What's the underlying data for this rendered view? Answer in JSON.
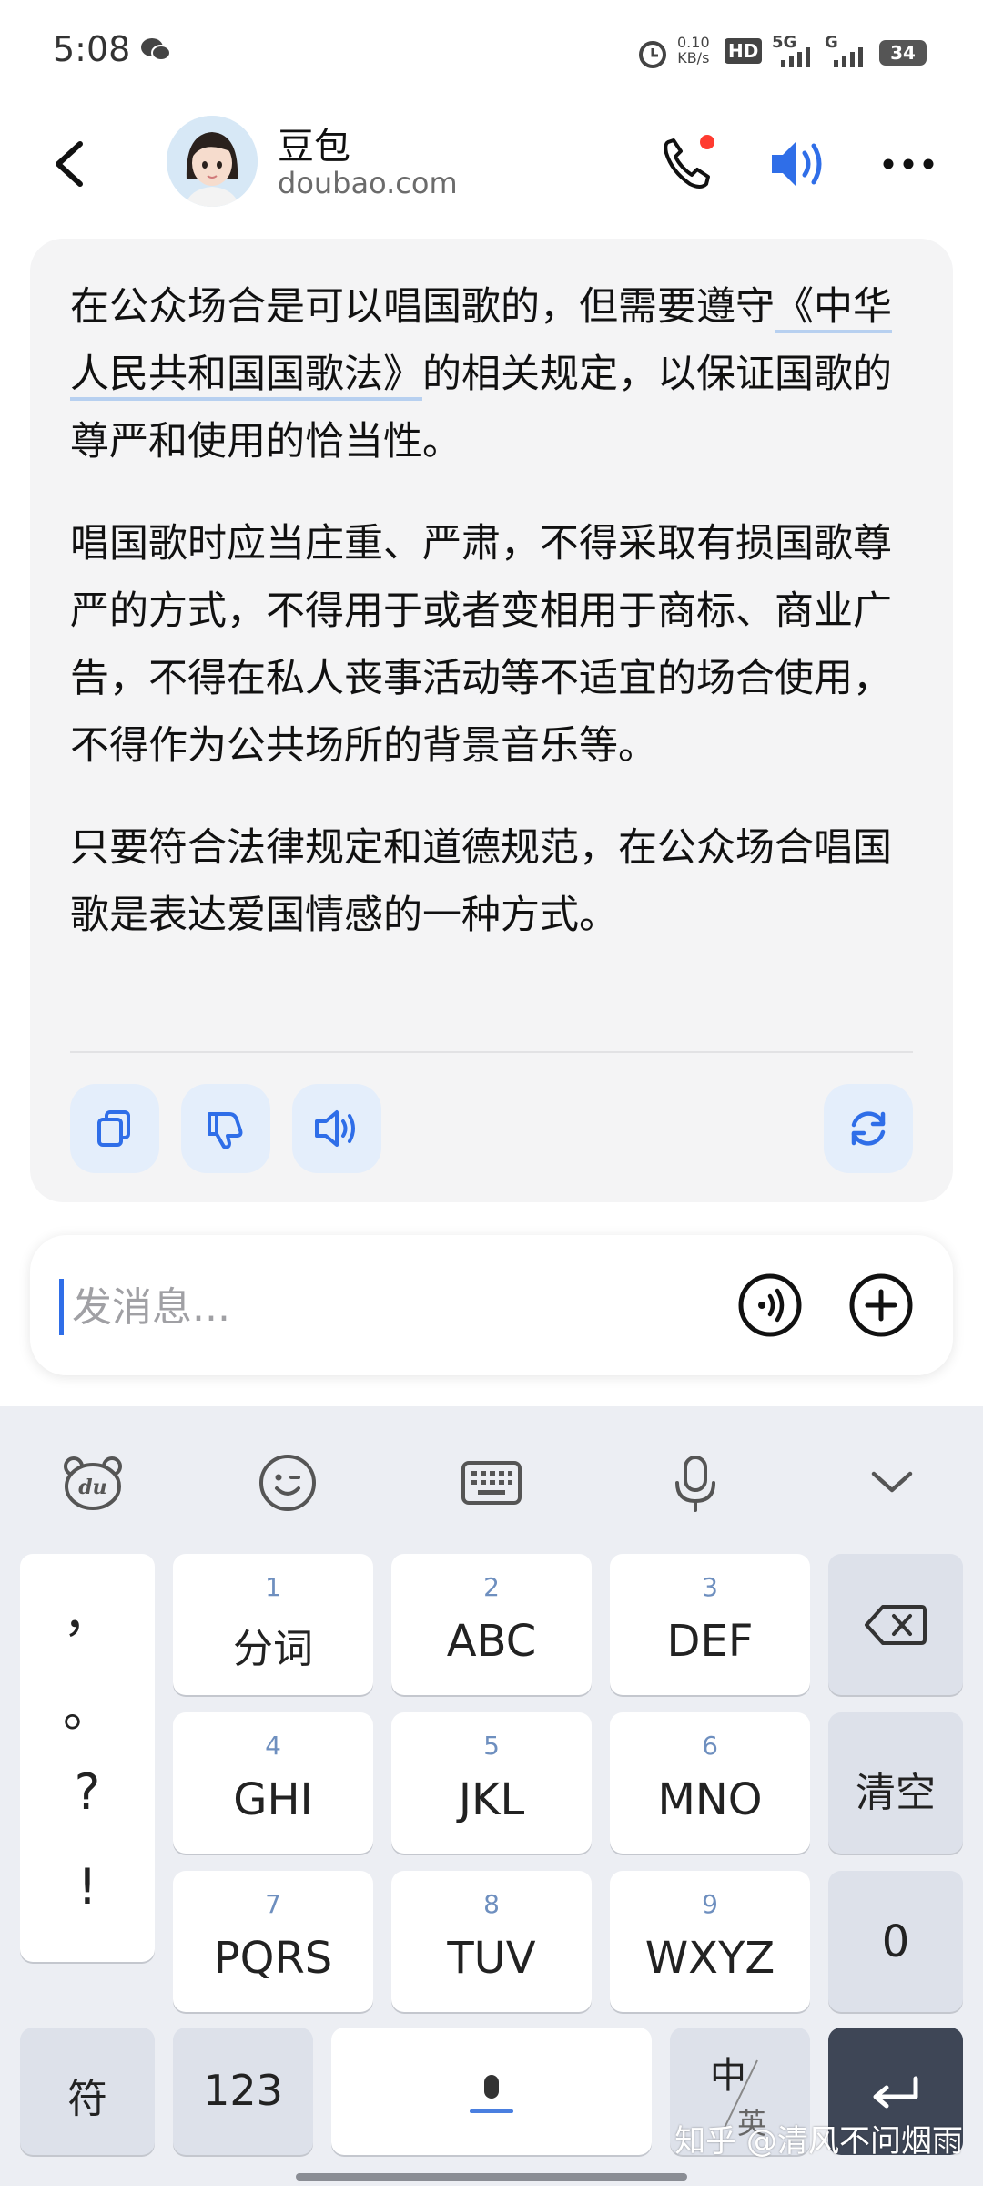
{
  "status_bar": {
    "time": "5:08",
    "network_speed_top": "0.10",
    "network_speed_unit": "KB/s",
    "hd_label": "HD",
    "sig1_label": "5G",
    "sig2_label": "G",
    "battery": "34"
  },
  "header": {
    "bot_name": "豆包",
    "bot_domain": "doubao.com",
    "call_badge_color": "#ff3b30",
    "accent_color": "#2f6ee8"
  },
  "message": {
    "p1_before": "在公众场合是可以唱国歌的，但需要遵守",
    "p1_link": "《中华人民共和国国歌法》",
    "p1_after": "的相关规定，以保证国歌的尊严和使用的恰当性。",
    "p2": "唱国歌时应当庄重、严肃，不得采取有损国歌尊严的方式，不得用于或者变相用于商标、商业广告，不得在私人丧事活动等不适宜的场合使用，不得作为公共场所的背景音乐等。",
    "p3": "只要符合法律规定和道德规范，在公众场合唱国歌是表达爱国情感的一种方式。",
    "actions": [
      "copy-icon",
      "thumbs-down-icon",
      "speaker-icon",
      "refresh-icon"
    ]
  },
  "input": {
    "placeholder": "发消息..."
  },
  "keyboard": {
    "toolbar": [
      "du-bear-icon",
      "emoji-icon",
      "keyboard-icon",
      "mic-icon",
      "chevron-down-icon"
    ],
    "punct": [
      "，",
      "。",
      "?",
      "!"
    ],
    "keys": [
      {
        "num": "1",
        "label": "分词"
      },
      {
        "num": "2",
        "label": "ABC"
      },
      {
        "num": "3",
        "label": "DEF"
      },
      {
        "num": "4",
        "label": "GHI"
      },
      {
        "num": "5",
        "label": "JKL"
      },
      {
        "num": "6",
        "label": "MNO"
      },
      {
        "num": "7",
        "label": "PQRS"
      },
      {
        "num": "8",
        "label": "TUV"
      },
      {
        "num": "9",
        "label": "WXYZ"
      }
    ],
    "clear_label": "清空",
    "zero_label": "0",
    "symbol_label": "符",
    "num_label": "123",
    "lang_top": "中",
    "lang_bottom": "英"
  },
  "watermark": "知乎 @清风不问烟雨"
}
